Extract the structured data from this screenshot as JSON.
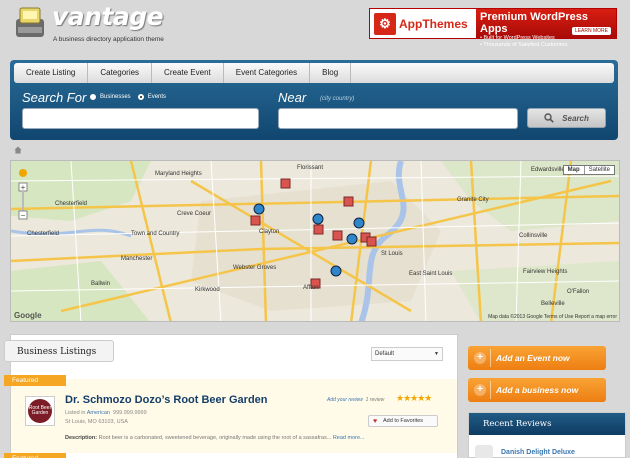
{
  "header": {
    "logo_text": "vantage",
    "tagline": "A business directory application theme"
  },
  "ad": {
    "brand": "AppThemes",
    "title": "Premium WordPress Apps",
    "line1": "• Built for WordPress Websites",
    "line2": "• Thousands of Satisfied Customers",
    "cta": "LEARN MORE"
  },
  "nav": {
    "items": [
      "Create Listing",
      "Categories",
      "Create Event",
      "Event Categories",
      "Blog"
    ]
  },
  "search": {
    "search_for_label": "Search For",
    "radio_businesses": "Businesses",
    "radio_events": "Events",
    "near_label": "Near",
    "near_hint": "(city country)",
    "query_value": "",
    "location_value": "",
    "button_label": "Search"
  },
  "map": {
    "type_map": "Map",
    "type_satellite": "Satellite",
    "credit": "Map data ©2013 Google   Terms of Use   Report a map error",
    "logo": "Google",
    "labels": [
      "Chesterfield",
      "Chesterfield",
      "Creve Coeur",
      "Clayton",
      "Kirkwood",
      "Affton",
      "St Louis",
      "East Saint Louis",
      "Collinsville",
      "Maryland Heights",
      "Ballwin",
      "Manchester",
      "Florissant",
      "Granite City",
      "Webster Groves",
      "Fairview Heights",
      "Town and Country",
      "Belleville",
      "Edwardsville",
      "O'Fallon"
    ]
  },
  "listings": {
    "tab_title": "Business Listings",
    "sort_value": "Default",
    "featured_label": "Featured",
    "item": {
      "logo_text": "Root Beer Garden",
      "title": "Dr. Schmozo Dozo’s Root Beer Garden",
      "listed_prefix": "Listed in",
      "category": "American",
      "phone": "999.999.9999",
      "address": "St Louis, MO 63103, USA",
      "review_link": "Add your review",
      "review_count": "1 review",
      "stars": "★★★★★",
      "fav_label": "Add to Favorites",
      "desc_label": "Description:",
      "desc_text": "Root beer is a carbonated, sweetened beverage, originally made using the root of a sassafras...",
      "more": "Read more..."
    }
  },
  "sidebar": {
    "add_event": "Add an Event now",
    "add_business": "Add a business now",
    "recent_title": "Recent Reviews",
    "recent_item": "Danish Delight Deluxe"
  },
  "colors": {
    "panel_blue": "#1a5985",
    "accent_orange": "#f39a27",
    "ad_red": "#d62818"
  }
}
